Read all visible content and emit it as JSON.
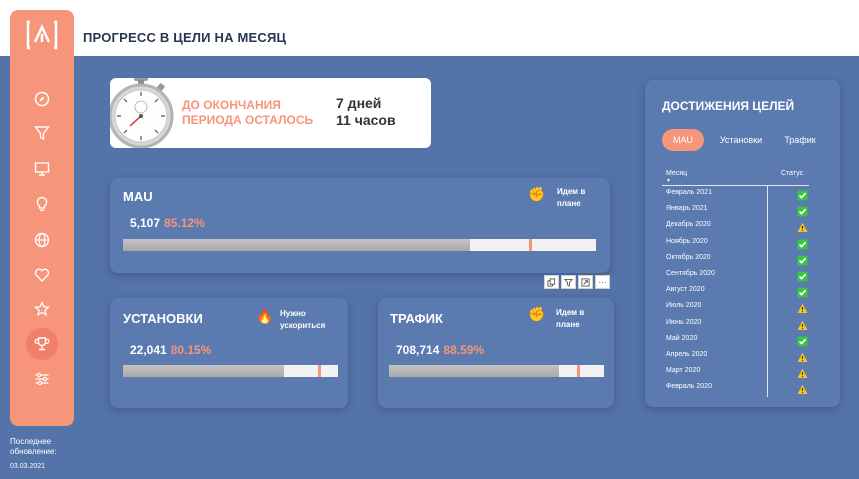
{
  "page": {
    "title": "ПРОГРЕСС В ЦЕЛИ НА МЕСЯЦ"
  },
  "sidebar": {
    "logo": "logo-icon",
    "items": [
      {
        "icon": "compass-icon",
        "active": false
      },
      {
        "icon": "funnel-icon",
        "active": false
      },
      {
        "icon": "monitor-icon",
        "active": false
      },
      {
        "icon": "lightbulb-icon",
        "active": false
      },
      {
        "icon": "globe-icon",
        "active": false
      },
      {
        "icon": "heart-icon",
        "active": false
      },
      {
        "icon": "star-icon",
        "active": false
      },
      {
        "icon": "trophy-icon",
        "active": true
      },
      {
        "icon": "sliders-icon",
        "active": false
      }
    ],
    "accent": "#f7957a"
  },
  "footer": {
    "label": "Последнее обновление:",
    "date": "03.03.2021"
  },
  "timer": {
    "label_line1": "ДО ОКОНЧАНИЯ",
    "label_line2": "ПЕРИОДА ОСТАЛОСЬ",
    "days": "7 дней",
    "hours": "11 часов",
    "icon": "stopwatch-icon"
  },
  "cards": {
    "mau": {
      "title": "MAU",
      "value": "5,107",
      "percent": "85.12%",
      "progress": 0.7333,
      "target_marker": 0.86,
      "status_icon": "fist-icon",
      "status_line1": "Идем в",
      "status_line2": "плане"
    },
    "installs": {
      "title": "УСТАНОВКИ",
      "value": "22,041",
      "percent": "80.15%",
      "progress": 0.75,
      "target_marker": 0.91,
      "status_icon": "fire-icon",
      "status_line1": "Нужно",
      "status_line2": "ускориться"
    },
    "traffic": {
      "title": "ТРАФИК",
      "value": "708,714",
      "percent": "88.59%",
      "progress": 0.79,
      "target_marker": 0.88,
      "status_icon": "fist-icon",
      "status_line1": "Идем в",
      "status_line2": "плане"
    }
  },
  "toolbar": {
    "icons": [
      "copy-icon",
      "filter-icon",
      "expand-icon",
      "more-icon"
    ],
    "more_label": "···"
  },
  "goals": {
    "title": "ДОСТИЖЕНИЯ ЦЕЛЕЙ",
    "tabs": [
      {
        "label": "MAU",
        "active": true
      },
      {
        "label": "Установки",
        "active": false
      },
      {
        "label": "Трафик",
        "active": false
      }
    ],
    "columns": {
      "month": "Месяц",
      "status": "Статус"
    },
    "sort_indicator": "▼",
    "rows": [
      {
        "month": "Февраль 2021",
        "status": "ok"
      },
      {
        "month": "Январь 2021",
        "status": "ok"
      },
      {
        "month": "Декабрь 2020",
        "status": "warn"
      },
      {
        "month": "Ноябрь 2020",
        "status": "ok"
      },
      {
        "month": "Октябрь 2020",
        "status": "ok"
      },
      {
        "month": "Сентябрь 2020",
        "status": "ok"
      },
      {
        "month": "Август 2020",
        "status": "ok"
      },
      {
        "month": "Июль 2020",
        "status": "warn"
      },
      {
        "month": "Июнь 2020",
        "status": "warn"
      },
      {
        "month": "Май 2020",
        "status": "ok"
      },
      {
        "month": "Апрель 2020",
        "status": "warn"
      },
      {
        "month": "Март 2020",
        "status": "warn"
      },
      {
        "month": "Февраль 2020",
        "status": "warn"
      }
    ],
    "colors": {
      "ok": "#3cc43c",
      "warn": "#f5c518",
      "tab_active": "#f7957a"
    }
  }
}
